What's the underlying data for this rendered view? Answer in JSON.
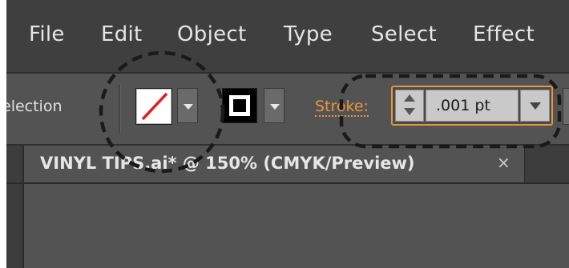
{
  "menu": {
    "items": [
      {
        "label": "File"
      },
      {
        "label": "Edit"
      },
      {
        "label": "Object"
      },
      {
        "label": "Type"
      },
      {
        "label": "Select"
      },
      {
        "label": "Effect"
      }
    ]
  },
  "control_bar": {
    "tool_label": "election",
    "fill": {
      "icon": "no-fill-swatch-icon",
      "slash_color": "#e02020"
    },
    "stroke": {
      "icon": "stroke-swatch-icon"
    },
    "stroke_label": "Stroke:",
    "stroke_weight": ".001 pt"
  },
  "document": {
    "tab_title": "VINYL TIPS.ai* @ 150% (CMYK/Preview)",
    "close_glyph": "×"
  },
  "colors": {
    "accent": "#e8963a",
    "menubar": "#3f3f3f",
    "panel": "#535353"
  }
}
